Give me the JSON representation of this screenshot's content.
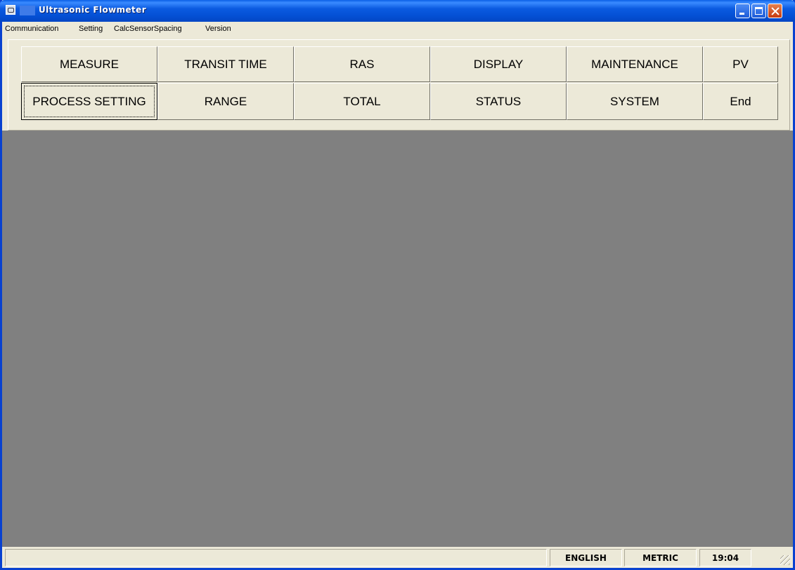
{
  "window": {
    "title": "Ultrasonic Flowmeter"
  },
  "menu": [
    "Communication",
    "Setting",
    "CalcSensorSpacing",
    "Version"
  ],
  "buttons_row1": [
    "MEASURE",
    "TRANSIT TIME",
    "RAS",
    "DISPLAY",
    "MAINTENANCE",
    "PV"
  ],
  "buttons_row2": [
    "PROCESS SETTING",
    "RANGE",
    "TOTAL",
    "STATUS",
    "SYSTEM",
    "End"
  ],
  "focused_button": "PROCESS SETTING",
  "status": {
    "language": "ENGLISH",
    "units": "METRIC",
    "time": "19:04"
  },
  "colors": {
    "title_bar": "#0A5FE6",
    "client_area": "#808080",
    "face": "#ECE9D8"
  }
}
